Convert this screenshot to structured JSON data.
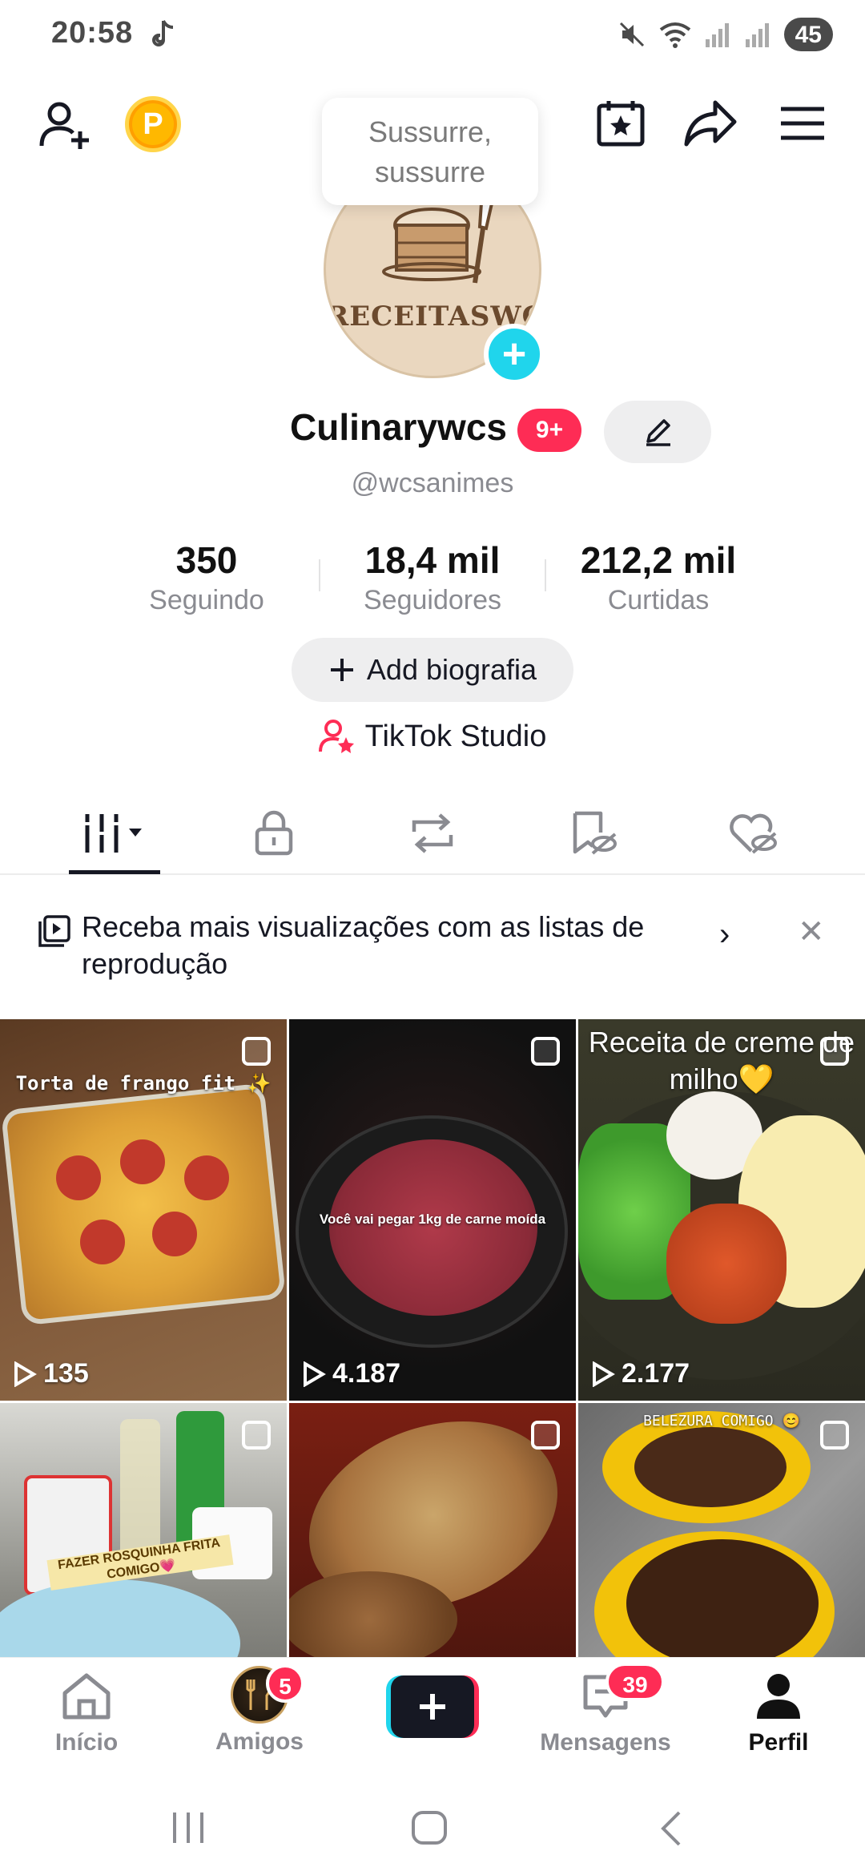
{
  "status_bar": {
    "time": "20:58",
    "battery": "45"
  },
  "tooltip": {
    "text": "Sussurre, sussurre"
  },
  "avatar": {
    "text": "RECEITASWCS"
  },
  "profile": {
    "display_name": "Culinarywcs",
    "badge": "9+",
    "username": "@wcsanimes"
  },
  "stats": [
    {
      "value": "350",
      "label": "Seguindo"
    },
    {
      "value": "18,4 mil",
      "label": "Seguidores"
    },
    {
      "value": "212,2 mil",
      "label": "Curtidas"
    }
  ],
  "bio_button": {
    "label": "Add biografia"
  },
  "studio": {
    "label": "TikTok Studio"
  },
  "banner": {
    "text": "Receba mais visualizações com as listas de reprodução"
  },
  "videos": [
    {
      "caption": "Torta de frango fit ✨",
      "views": "135"
    },
    {
      "caption": "Você vai pegar 1kg de carne moída",
      "views": "4.187"
    },
    {
      "caption": "Receita de creme de milho💛",
      "views": "2.177"
    },
    {
      "caption": "FAZER ROSQUINHA FRITA COMIGO💗",
      "views": ""
    },
    {
      "caption": "",
      "views": ""
    },
    {
      "caption": "BELEZURA COMIGO 😊",
      "views": ""
    }
  ],
  "bottom_nav": [
    {
      "label": "Início"
    },
    {
      "label": "Amigos",
      "badge": "5"
    },
    {
      "label": ""
    },
    {
      "label": "Mensagens",
      "badge": "39"
    },
    {
      "label": "Perfil"
    }
  ],
  "colors": {
    "accent": "#fe2c55",
    "cyan": "#20d5ec",
    "text": "#161823",
    "muted": "#8a8b91"
  }
}
